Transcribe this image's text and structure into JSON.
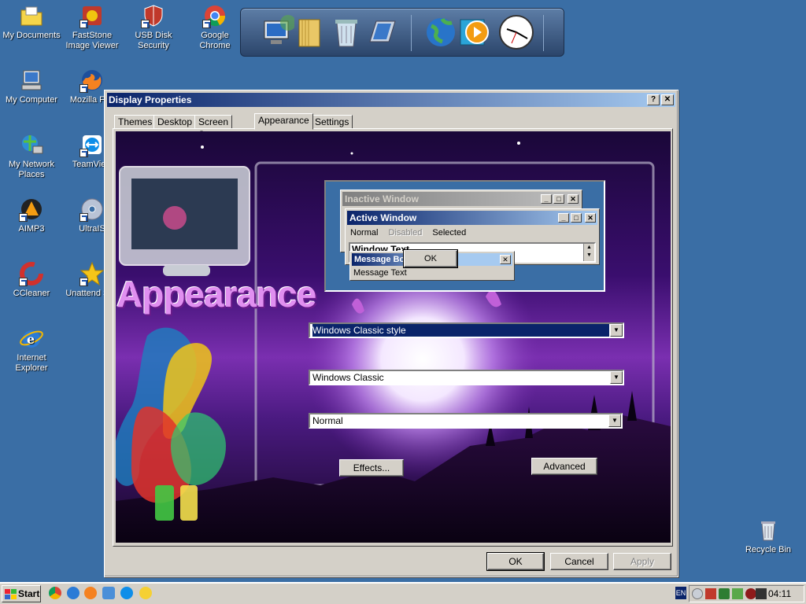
{
  "desktop": {
    "icons": [
      {
        "label": "My Documents"
      },
      {
        "label": "FastStone Image Viewer"
      },
      {
        "label": "USB Disk Security"
      },
      {
        "label": "Google Chrome"
      },
      {
        "label": "My Computer"
      },
      {
        "label": "Mozilla Fire"
      },
      {
        "label": "My Network Places"
      },
      {
        "label": "TeamView"
      },
      {
        "label": "AIMP3"
      },
      {
        "label": "UltraIS"
      },
      {
        "label": "CCleaner"
      },
      {
        "label": "Unattend Soft"
      },
      {
        "label": "Internet Explorer"
      },
      {
        "label": "Recycle Bin"
      }
    ]
  },
  "dock": {
    "items": [
      "my-computer-icon",
      "folder-icon",
      "recycle-bin-icon",
      "display-settings-icon",
      "globe-icon",
      "media-player-icon",
      "clock-icon"
    ]
  },
  "window": {
    "title": "Display Properties",
    "help_label": "?",
    "close_label": "✕",
    "tabs": [
      {
        "label": "Themes"
      },
      {
        "label": "Desktop"
      },
      {
        "label": "Screen Saver"
      },
      {
        "label": "Appearance",
        "active": true
      },
      {
        "label": "Settings"
      }
    ],
    "banner_text": "Appearance",
    "preview": {
      "inactive_title": "Inactive Window",
      "active_title": "Active Window",
      "menu": {
        "normal": "Normal",
        "disabled": "Disabled",
        "selected": "Selected"
      },
      "window_text": "Window Text",
      "message_box_title": "Message Box",
      "message_text": "Message Text",
      "ok_label": "OK"
    },
    "windows_and_buttons": {
      "value": "Windows Classic style"
    },
    "color_scheme": {
      "value": "Windows Classic"
    },
    "font_size": {
      "value": "Normal"
    },
    "effects_label": "Effects...",
    "advanced_label": "Advanced",
    "ok_label": "OK",
    "cancel_label": "Cancel",
    "apply_label": "Apply"
  },
  "taskbar": {
    "start_label": "Start",
    "language": "EN",
    "time": "04:11"
  },
  "colors": {
    "desktop": "#3a6ea5",
    "titlebar_start": "#0a246a",
    "titlebar_end": "#a6caf0",
    "face": "#d4d0c8"
  }
}
